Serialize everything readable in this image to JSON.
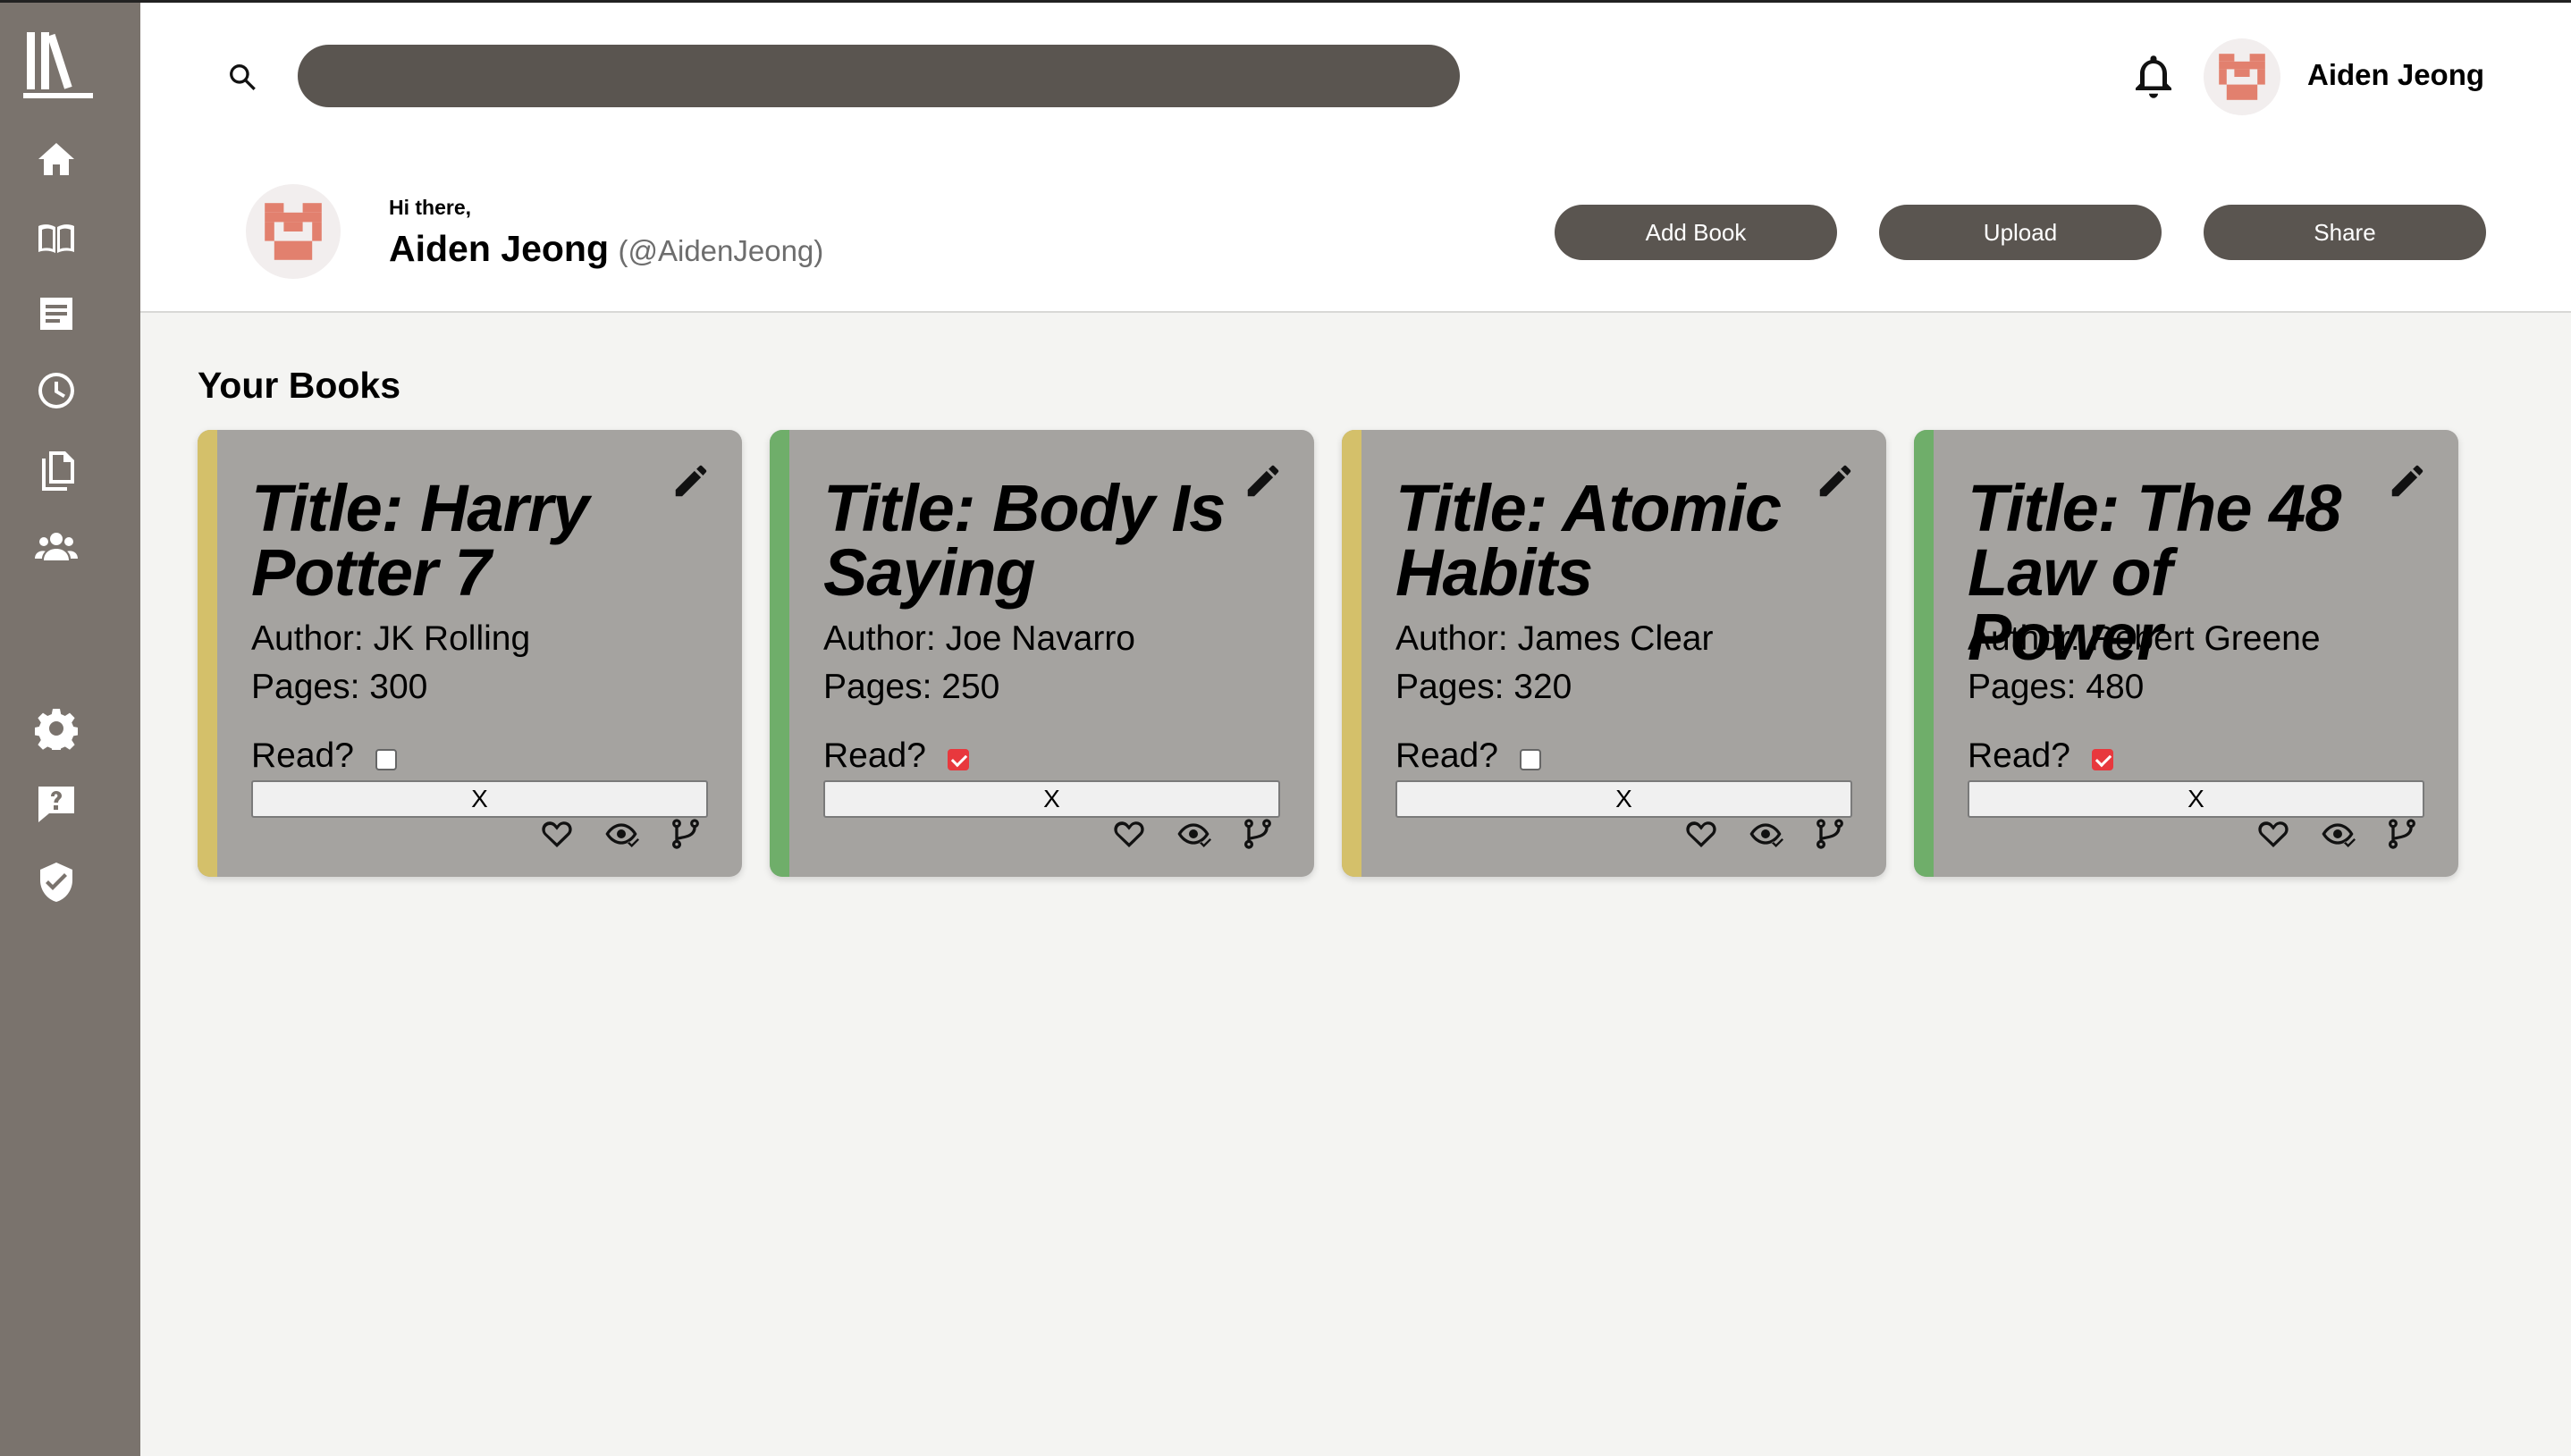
{
  "header": {
    "search": {
      "value": "",
      "placeholder": ""
    },
    "username": "Aiden Jeong"
  },
  "profile": {
    "greeting": "Hi there,",
    "name": "Aiden Jeong",
    "handle": "(@AidenJeong)"
  },
  "actions": {
    "add_book": "Add Book",
    "upload": "Upload",
    "share": "Share"
  },
  "sidebar": {
    "items": [
      {
        "icon": "logo-icon"
      },
      {
        "icon": "home-icon"
      },
      {
        "icon": "book-icon"
      },
      {
        "icon": "articles-icon"
      },
      {
        "icon": "history-icon"
      },
      {
        "icon": "documents-icon"
      },
      {
        "icon": "people-icon"
      },
      {
        "icon": "settings-icon"
      },
      {
        "icon": "help-icon"
      },
      {
        "icon": "shield-icon"
      }
    ]
  },
  "section_title": "Your Books",
  "read_label": "Read?",
  "remove_label": "X",
  "books": [
    {
      "title": "Title: Harry Potter 7",
      "author": "Author: JK Rolling",
      "pages": "Pages: 300",
      "read": false,
      "accent": "#d4c06a"
    },
    {
      "title": "Title: Body Is Saying",
      "author": "Author: Joe Navarro",
      "pages": "Pages: 250",
      "read": true,
      "accent": "#6fae6a"
    },
    {
      "title": "Title: Atomic Habits",
      "author": "Author: James Clear",
      "pages": "Pages: 320",
      "read": false,
      "accent": "#d4c06a"
    },
    {
      "title": "Title: The 48 Law of Power",
      "author": "Author: Robert Greene",
      "pages": "Pages: 480",
      "read": true,
      "accent": "#6fae6a"
    }
  ],
  "colors": {
    "sidebar": "#7a736d",
    "button": "#5a5550",
    "card": "#a5a3a0",
    "checkbox_checked": "#e8383d"
  }
}
